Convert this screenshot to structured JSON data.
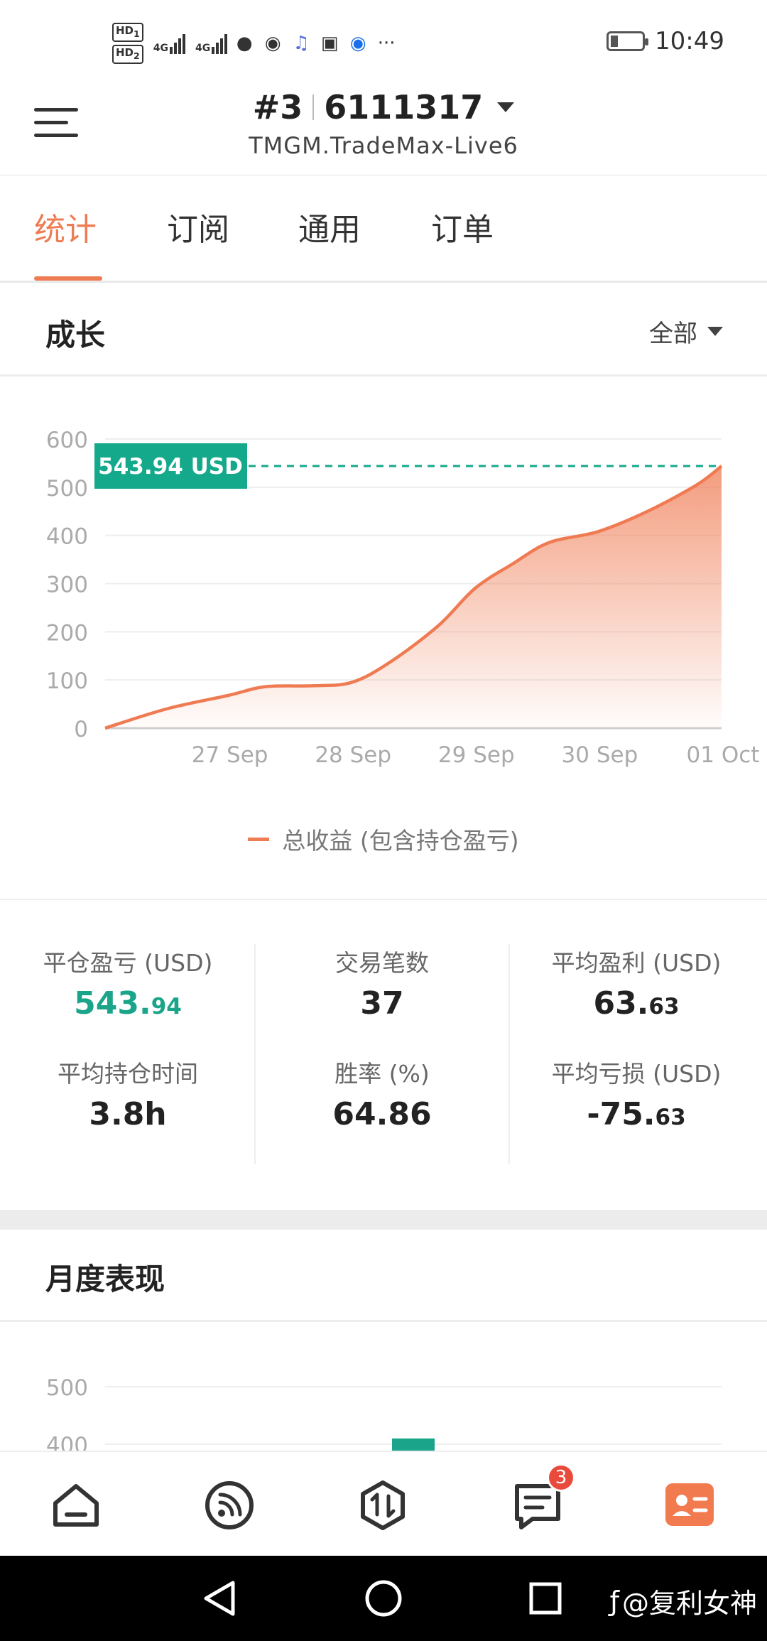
{
  "status_bar": {
    "hd1": "HD",
    "hd1_sub": "1",
    "hd2": "HD",
    "hd2_sub": "2",
    "net1": "4G",
    "net2": "4G",
    "more": "···",
    "time": "10:49",
    "icons": [
      "qq-icon",
      "chat-icon",
      "music-icon",
      "huawei-icon",
      "bulb-icon"
    ]
  },
  "header": {
    "account_prefix": "#3",
    "account_id": "6111317",
    "server": "TMGM.TradeMax-Live6"
  },
  "tabs": [
    {
      "label": "统计",
      "active": true
    },
    {
      "label": "订阅",
      "active": false
    },
    {
      "label": "通用",
      "active": false
    },
    {
      "label": "订单",
      "active": false
    }
  ],
  "growth": {
    "title": "成长",
    "filter": "全部",
    "current_label": "543.94 USD",
    "legend": "总收益 (包含持仓盈亏)"
  },
  "chart_data": [
    {
      "type": "area",
      "x_ticks": [
        "27 Sep",
        "28 Sep",
        "29 Sep",
        "30 Sep",
        "01 Oct"
      ],
      "y_ticks": [
        "0",
        "100",
        "200",
        "300",
        "400",
        "500",
        "600"
      ],
      "ylim": [
        0,
        600
      ],
      "grid": true,
      "series": [
        {
          "name": "总收益 (包含持仓盈亏)",
          "x": [
            "26 Sep",
            "26.5 Sep",
            "27 Sep",
            "27.3 Sep",
            "27.7 Sep",
            "28 Sep",
            "28.3 Sep",
            "28.7 Sep",
            "29 Sep",
            "29.3 Sep",
            "29.6 Sep",
            "30 Sep",
            "30.4 Sep",
            "30.8 Sep",
            "01 Oct"
          ],
          "x_pos": [
            0,
            0.5,
            1.0,
            1.3,
            1.7,
            2.0,
            2.3,
            2.7,
            3.0,
            3.3,
            3.6,
            4.0,
            4.4,
            4.8,
            5.0
          ],
          "values": [
            0,
            40,
            68,
            86,
            88,
            95,
            135,
            212,
            290,
            340,
            385,
            408,
            450,
            505,
            543.94
          ],
          "color": "#ef7b53"
        }
      ],
      "marker": {
        "value": 543.94,
        "label": "543.94 USD",
        "color": "#14a98b"
      }
    },
    {
      "type": "bar",
      "title": "月度表现",
      "y_ticks": [
        "500",
        "400"
      ],
      "values_visible": [
        {
          "value": 410,
          "color": "#1aa58a"
        }
      ]
    }
  ],
  "stats": {
    "closed_pl_label": "平仓盈亏 (USD)",
    "closed_pl_int": "543.",
    "closed_pl_dec": "94",
    "trades_label": "交易笔数",
    "trades": "37",
    "avg_profit_label": "平均盈利 (USD)",
    "avg_profit_int": "63.",
    "avg_profit_dec": "63",
    "avg_hold_label": "平均持仓时间",
    "avg_hold": "3.8h",
    "win_rate_label": "胜率 (%)",
    "win_rate": "64.86",
    "avg_loss_label": "平均亏损 (USD)",
    "avg_loss_int": "-75.",
    "avg_loss_dec": "63"
  },
  "monthly": {
    "title": "月度表现"
  },
  "bottom_nav": {
    "items": [
      "home-icon",
      "feed-icon",
      "trade-icon",
      "messages-icon",
      "profile-icon"
    ],
    "messages_badge": "3",
    "active_color": "#f27a4f"
  },
  "watermark": "@复利女神"
}
